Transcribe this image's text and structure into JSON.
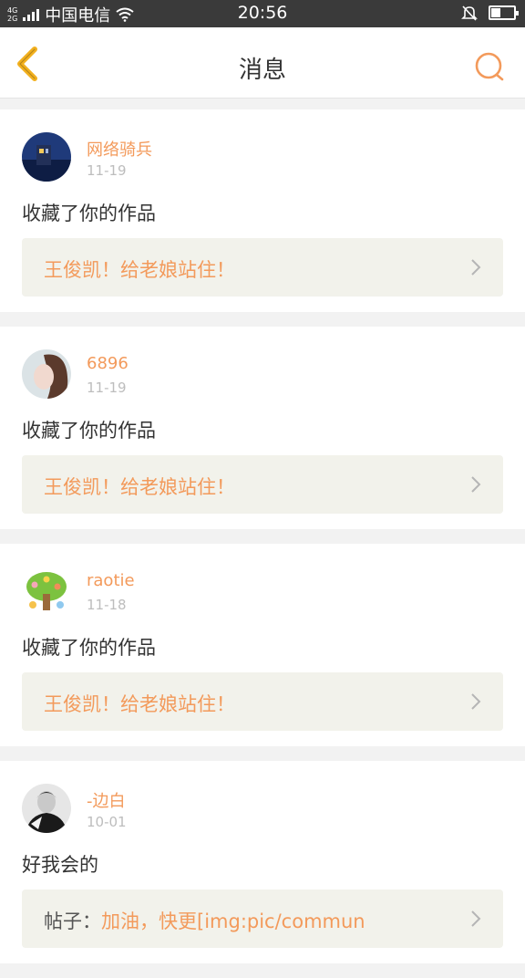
{
  "status_bar": {
    "network_top": "4G",
    "network_bottom": "2G",
    "carrier": "中国电信",
    "time": "20:56"
  },
  "header": {
    "title": "消息"
  },
  "colors": {
    "accent": "#f39a5b",
    "back_icon": "#f2b01e"
  },
  "messages": [
    {
      "user": "网络骑兵",
      "date": "11-19",
      "action": "收藏了你的作品",
      "ref_prefix": "",
      "ref_text": "王俊凯！给老娘站住！",
      "avatar": "night-photo-avatar"
    },
    {
      "user": "6896",
      "date": "11-19",
      "action": "收藏了你的作品",
      "ref_prefix": "",
      "ref_text": "王俊凯！给老娘站住！",
      "avatar": "girl-portrait-avatar"
    },
    {
      "user": "raotie",
      "date": "11-18",
      "action": "收藏了你的作品",
      "ref_prefix": "",
      "ref_text": "王俊凯！给老娘站住！",
      "avatar": "cartoon-tree-avatar"
    },
    {
      "user": "-边白",
      "date": "10-01",
      "action": "好我会的",
      "ref_prefix": "帖子：",
      "ref_text": "加油，快更[img:pic/commun",
      "avatar": "bw-portrait-avatar"
    }
  ]
}
